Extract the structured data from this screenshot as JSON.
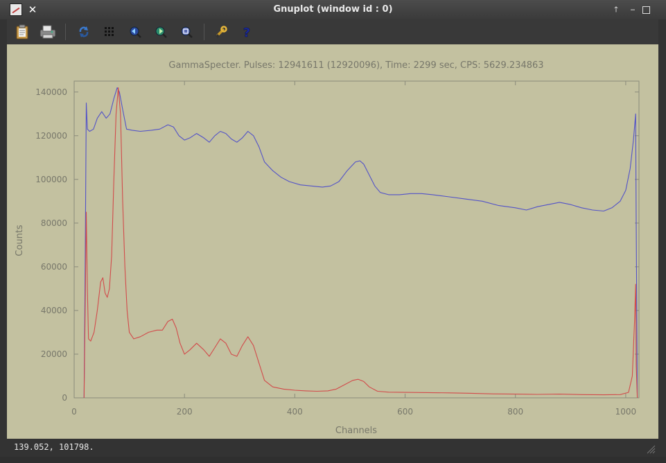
{
  "window": {
    "title": "Gnuplot (window id : 0)",
    "close_label": "✕",
    "buttons": [
      "🡑",
      "‒",
      "□"
    ]
  },
  "toolbar": {
    "items": [
      {
        "icon": "clipboard-icon"
      },
      {
        "icon": "print-icon"
      },
      {
        "icon": "replot-icon"
      },
      {
        "icon": "grid-icon"
      },
      {
        "icon": "zoom-previous-icon"
      },
      {
        "icon": "zoom-next-icon"
      },
      {
        "icon": "autoscale-icon"
      },
      {
        "icon": "settings-wrench-icon"
      },
      {
        "icon": "help-icon"
      }
    ]
  },
  "status": {
    "coordinates": "139.052,  101798."
  },
  "chart_data": {
    "type": "line",
    "title": "GammaSpecter. Pulses: 12941611 (12920096), Time: 2299 sec, CPS: 5629.234863",
    "xlabel": "Channels",
    "ylabel": "Counts",
    "xlim": [
      0,
      1024
    ],
    "ylim": [
      0,
      145000
    ],
    "xticks": [
      0,
      200,
      400,
      600,
      800,
      1000
    ],
    "yticks": [
      0,
      20000,
      40000,
      60000,
      80000,
      100000,
      120000,
      140000
    ],
    "grid": false,
    "legend": "none",
    "series": [
      {
        "color": "#5252c8",
        "points": [
          [
            18,
            0
          ],
          [
            20,
            60000
          ],
          [
            22,
            135000
          ],
          [
            24,
            123000
          ],
          [
            28,
            122000
          ],
          [
            35,
            123000
          ],
          [
            42,
            128000
          ],
          [
            50,
            131000
          ],
          [
            58,
            128000
          ],
          [
            65,
            130000
          ],
          [
            72,
            137000
          ],
          [
            78,
            142000
          ],
          [
            82,
            140000
          ],
          [
            88,
            132000
          ],
          [
            95,
            123000
          ],
          [
            105,
            122500
          ],
          [
            120,
            122000
          ],
          [
            140,
            122500
          ],
          [
            155,
            123000
          ],
          [
            170,
            125000
          ],
          [
            180,
            124000
          ],
          [
            190,
            120000
          ],
          [
            200,
            118000
          ],
          [
            210,
            119000
          ],
          [
            222,
            121000
          ],
          [
            235,
            119000
          ],
          [
            245,
            117000
          ],
          [
            255,
            120000
          ],
          [
            265,
            122000
          ],
          [
            275,
            121000
          ],
          [
            285,
            118500
          ],
          [
            295,
            117000
          ],
          [
            305,
            119000
          ],
          [
            315,
            122000
          ],
          [
            325,
            120000
          ],
          [
            335,
            115000
          ],
          [
            345,
            108000
          ],
          [
            360,
            104000
          ],
          [
            375,
            101000
          ],
          [
            390,
            99000
          ],
          [
            410,
            97500
          ],
          [
            430,
            97000
          ],
          [
            450,
            96500
          ],
          [
            465,
            97000
          ],
          [
            480,
            99000
          ],
          [
            495,
            104000
          ],
          [
            510,
            108000
          ],
          [
            518,
            108500
          ],
          [
            525,
            107000
          ],
          [
            535,
            102000
          ],
          [
            545,
            97000
          ],
          [
            555,
            94000
          ],
          [
            570,
            93000
          ],
          [
            590,
            93000
          ],
          [
            610,
            93500
          ],
          [
            630,
            93500
          ],
          [
            650,
            93000
          ],
          [
            680,
            92000
          ],
          [
            710,
            91000
          ],
          [
            740,
            90000
          ],
          [
            770,
            88000
          ],
          [
            800,
            87000
          ],
          [
            820,
            86000
          ],
          [
            840,
            87500
          ],
          [
            860,
            88500
          ],
          [
            880,
            89500
          ],
          [
            900,
            88500
          ],
          [
            920,
            87000
          ],
          [
            940,
            86000
          ],
          [
            960,
            85500
          ],
          [
            975,
            87000
          ],
          [
            990,
            90000
          ],
          [
            1000,
            95000
          ],
          [
            1008,
            105000
          ],
          [
            1014,
            118000
          ],
          [
            1018,
            130000
          ],
          [
            1019,
            80000
          ],
          [
            1021,
            0
          ]
        ]
      },
      {
        "color": "#d24a4a",
        "points": [
          [
            18,
            0
          ],
          [
            20,
            40000
          ],
          [
            22,
            85000
          ],
          [
            24,
            50000
          ],
          [
            26,
            27000
          ],
          [
            30,
            26000
          ],
          [
            36,
            30000
          ],
          [
            42,
            40000
          ],
          [
            48,
            53000
          ],
          [
            52,
            55000
          ],
          [
            56,
            48000
          ],
          [
            60,
            46000
          ],
          [
            64,
            50000
          ],
          [
            68,
            65000
          ],
          [
            72,
            100000
          ],
          [
            76,
            130000
          ],
          [
            80,
            142000
          ],
          [
            84,
            130000
          ],
          [
            88,
            90000
          ],
          [
            92,
            60000
          ],
          [
            96,
            40000
          ],
          [
            100,
            30000
          ],
          [
            108,
            27000
          ],
          [
            120,
            28000
          ],
          [
            135,
            30000
          ],
          [
            150,
            31000
          ],
          [
            160,
            31000
          ],
          [
            170,
            35000
          ],
          [
            178,
            36000
          ],
          [
            185,
            32000
          ],
          [
            192,
            25000
          ],
          [
            200,
            20000
          ],
          [
            210,
            22000
          ],
          [
            222,
            25000
          ],
          [
            235,
            22000
          ],
          [
            245,
            19000
          ],
          [
            255,
            23000
          ],
          [
            265,
            27000
          ],
          [
            275,
            25000
          ],
          [
            285,
            20000
          ],
          [
            295,
            19000
          ],
          [
            305,
            24000
          ],
          [
            315,
            28000
          ],
          [
            325,
            24000
          ],
          [
            335,
            16000
          ],
          [
            345,
            8000
          ],
          [
            360,
            5000
          ],
          [
            380,
            4000
          ],
          [
            400,
            3500
          ],
          [
            420,
            3200
          ],
          [
            440,
            3000
          ],
          [
            460,
            3200
          ],
          [
            475,
            4000
          ],
          [
            490,
            6000
          ],
          [
            505,
            8000
          ],
          [
            515,
            8500
          ],
          [
            525,
            7500
          ],
          [
            535,
            5000
          ],
          [
            550,
            3000
          ],
          [
            570,
            2600
          ],
          [
            600,
            2500
          ],
          [
            640,
            2400
          ],
          [
            680,
            2300
          ],
          [
            720,
            2100
          ],
          [
            760,
            1800
          ],
          [
            800,
            1700
          ],
          [
            840,
            1600
          ],
          [
            880,
            1700
          ],
          [
            920,
            1500
          ],
          [
            960,
            1400
          ],
          [
            990,
            1500
          ],
          [
            1005,
            2500
          ],
          [
            1012,
            10000
          ],
          [
            1016,
            35000
          ],
          [
            1018,
            52000
          ],
          [
            1019,
            15000
          ],
          [
            1021,
            0
          ]
        ]
      }
    ]
  }
}
